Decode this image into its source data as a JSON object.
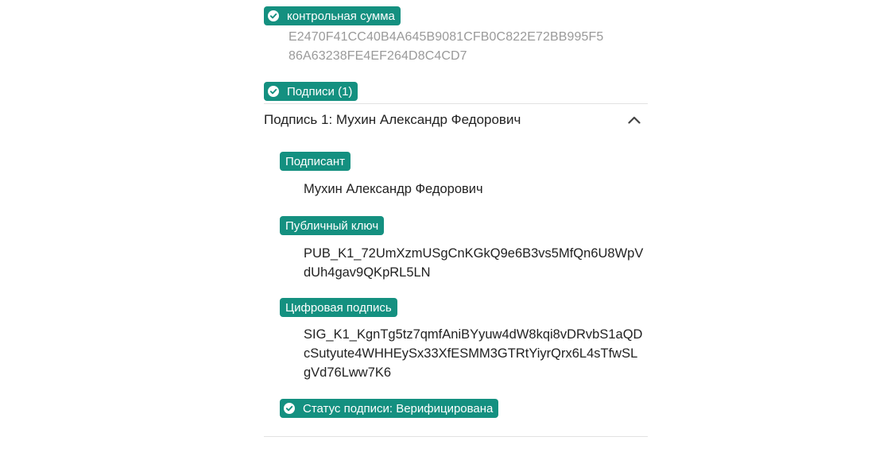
{
  "checksum": {
    "label": "контрольная сумма",
    "value_line1": "E2470F41CC40B4A645B9081CFB0C822E72BB995F5",
    "value_line2": "86A63238FE4EF264D8C4CD7"
  },
  "signatures": {
    "label": "Подписи (1)",
    "items": [
      {
        "title": "Подпись 1: Мухин Александр Федорович",
        "signer_label": "Подписант",
        "signer_value": "Мухин Александр Федорович",
        "public_key_label": "Публичный ключ",
        "public_key_line1": "PUB_K1_72UmXzmUSgCnKGkQ9e6B3vs5MfQn6U8WpV",
        "public_key_line2": "dUh4gav9QKpRL5LN",
        "digital_signature_label": "Цифровая подпись",
        "digital_signature_line1": "SIG_K1_KgnTg5tz7qmfAniBYyuw4dW8kqi8vDRvbS1aQD",
        "digital_signature_line2": "cSutyute4WHHEySx33XfESMM3GTRtYiyrQrx6L4sTfwSL",
        "digital_signature_line3": "gVd76Lww7K6",
        "status_label": "Статус подписи: Верифицирована"
      }
    ]
  },
  "icons": {
    "check": "check-circle-icon",
    "collapse": "chevron-up-icon"
  },
  "colors": {
    "accent": "#149080",
    "muted_text": "#9a9a9a",
    "divider": "#e2e2e2"
  }
}
